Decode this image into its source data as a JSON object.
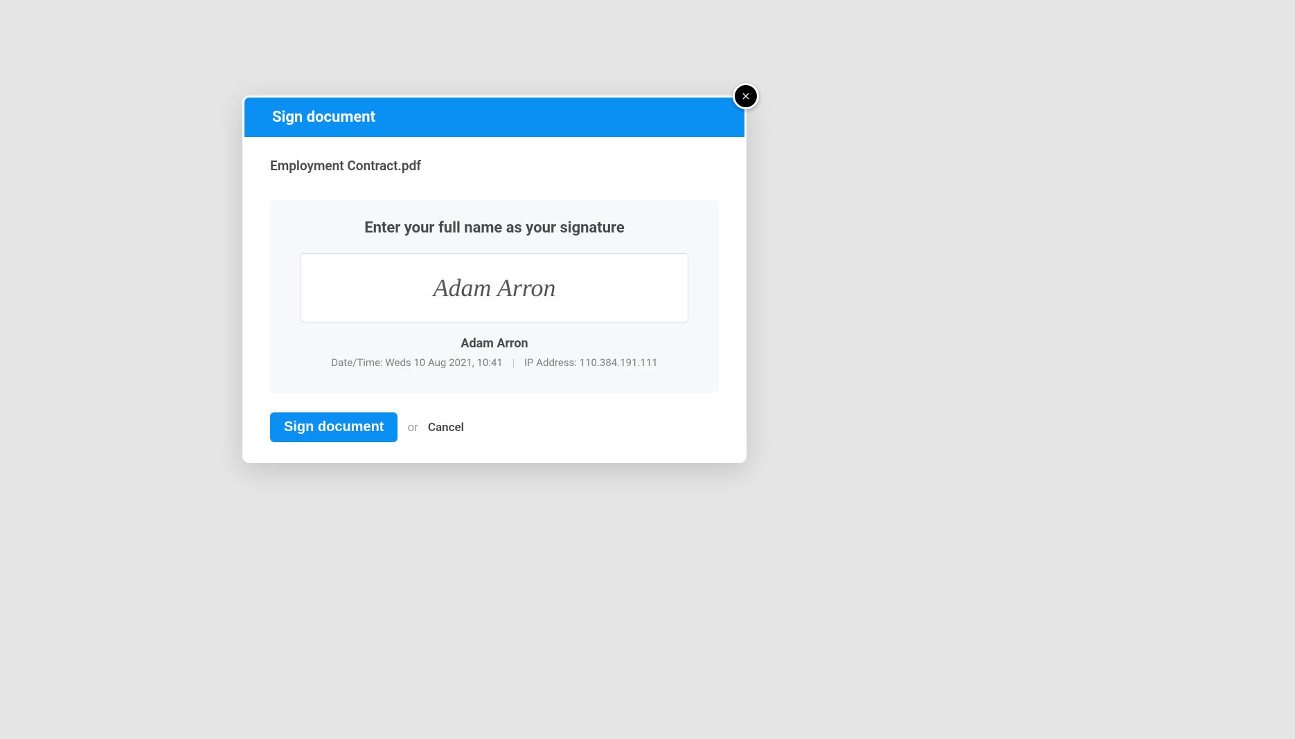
{
  "modal": {
    "title": "Sign document",
    "close_label": "Close",
    "document_name": "Employment Contract.pdf",
    "signature": {
      "instruction": "Enter your full name as your signature",
      "value": "Adam Arron",
      "signed_by": "Adam Arron",
      "datetime_label": "Date/Time:",
      "datetime_value": "Weds 10 Aug 2021, 10:41",
      "ip_label": "IP Address:",
      "ip_value": "110.384.191.111"
    },
    "actions": {
      "sign_label": "Sign document",
      "or_text": "or",
      "cancel_label": "Cancel"
    }
  },
  "colors": {
    "accent": "#0a8ff2",
    "background": "#e5e5e5",
    "panel_bg": "#f7f8f9",
    "text_dark": "#4a4a4a",
    "text_muted": "#7c7f82"
  }
}
